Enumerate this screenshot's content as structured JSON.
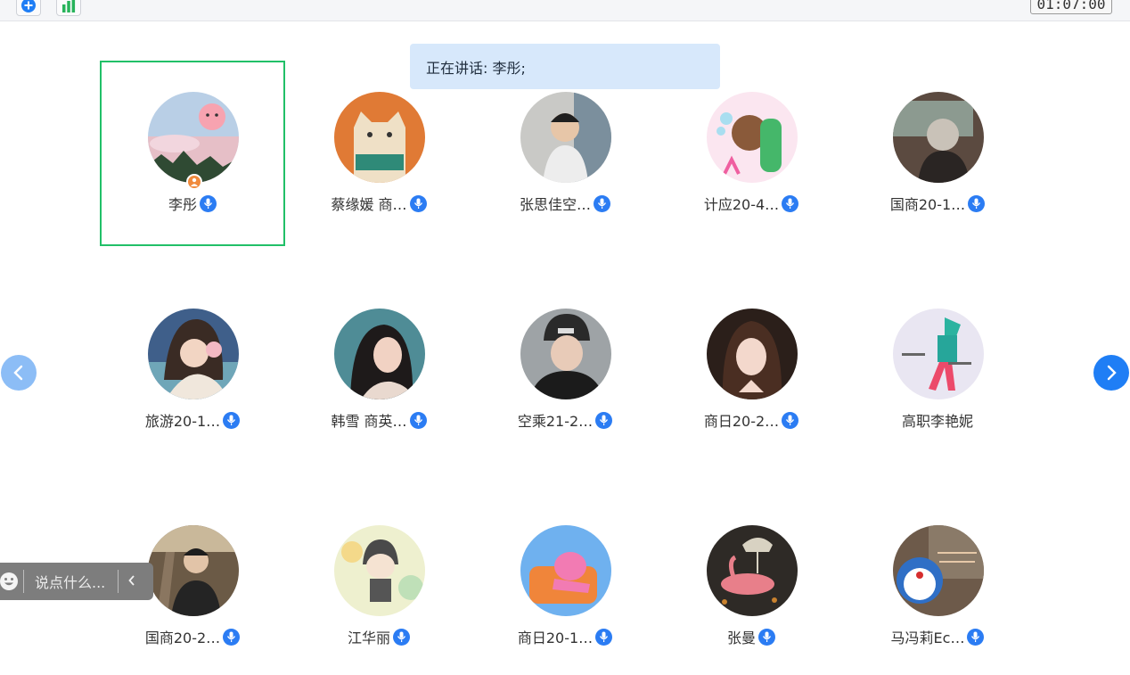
{
  "toolbar": {
    "timer": "01:07:00",
    "add_icon": "plus-circle-icon",
    "stats_icon": "bar-chart-icon"
  },
  "speaking_banner": "正在讲话: 李彤;",
  "participants": [
    {
      "name": "李彤",
      "mic": true,
      "host": true
    },
    {
      "name": "蔡缘媛 商…",
      "mic": true
    },
    {
      "name": "张思佳空…",
      "mic": true
    },
    {
      "name": "计应20-4…",
      "mic": true
    },
    {
      "name": "国商20-1…",
      "mic": true
    },
    {
      "name": "旅游20-1…",
      "mic": true
    },
    {
      "name": "韩雪 商英…",
      "mic": true
    },
    {
      "name": "空乘21-2…",
      "mic": true
    },
    {
      "name": "商日20-2…",
      "mic": true
    },
    {
      "name": "高职李艳妮",
      "mic": false
    },
    {
      "name": "国商20-2…",
      "mic": true
    },
    {
      "name": "江华丽",
      "mic": true
    },
    {
      "name": "商日20-1…",
      "mic": true
    },
    {
      "name": "张曼",
      "mic": true
    },
    {
      "name": "马冯莉Ec…",
      "mic": true
    }
  ],
  "chat": {
    "placeholder": "说点什么...",
    "emoji_icon": "smiley-icon",
    "collapse_icon": "chevron-left-icon"
  },
  "navigation": {
    "prev_icon": "chevron-left-icon",
    "next_icon": "chevron-right-icon"
  },
  "colors": {
    "speaking_highlight": "#21c068",
    "mic_badge": "#2b7cf3",
    "banner_bg": "#d7e8fb",
    "nav_active": "#1f7ef5",
    "nav_inactive": "#8cbdf6"
  }
}
